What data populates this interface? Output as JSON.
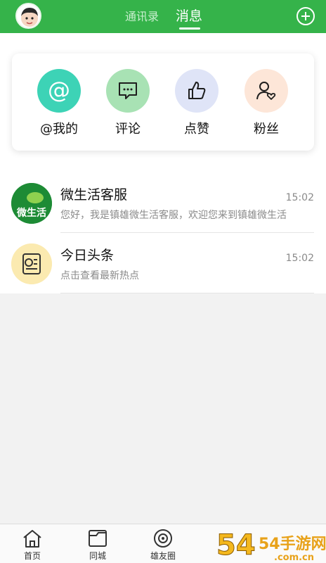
{
  "header": {
    "tabs": [
      {
        "label": "通讯录",
        "active": false
      },
      {
        "label": "消息",
        "active": true
      }
    ],
    "accent": "#35b34a"
  },
  "shortcuts": [
    {
      "label": "@我的",
      "icon": "at-icon",
      "color": "#3dd3b6"
    },
    {
      "label": "评论",
      "icon": "comment-icon",
      "color": "#a8e2b4"
    },
    {
      "label": "点赞",
      "icon": "thumbs-up-icon",
      "color": "#dfe4f7"
    },
    {
      "label": "粉丝",
      "icon": "fans-icon",
      "color": "#fde6d8"
    }
  ],
  "messages": [
    {
      "name": "微生活客服",
      "preview": "您好，我是镇雄微生活客服，欢迎您来到镇雄微生活",
      "time": "15:02",
      "logo_text": "微生活"
    },
    {
      "name": "今日头条",
      "preview": "点击查看最新热点",
      "time": "15:02"
    }
  ],
  "bottom_nav": [
    {
      "label": "首页",
      "icon": "home-icon"
    },
    {
      "label": "同城",
      "icon": "folder-icon"
    },
    {
      "label": "雄友圈",
      "icon": "circle-icon"
    }
  ],
  "watermark": {
    "text": "54手游网",
    "sub": ".com.cn"
  }
}
